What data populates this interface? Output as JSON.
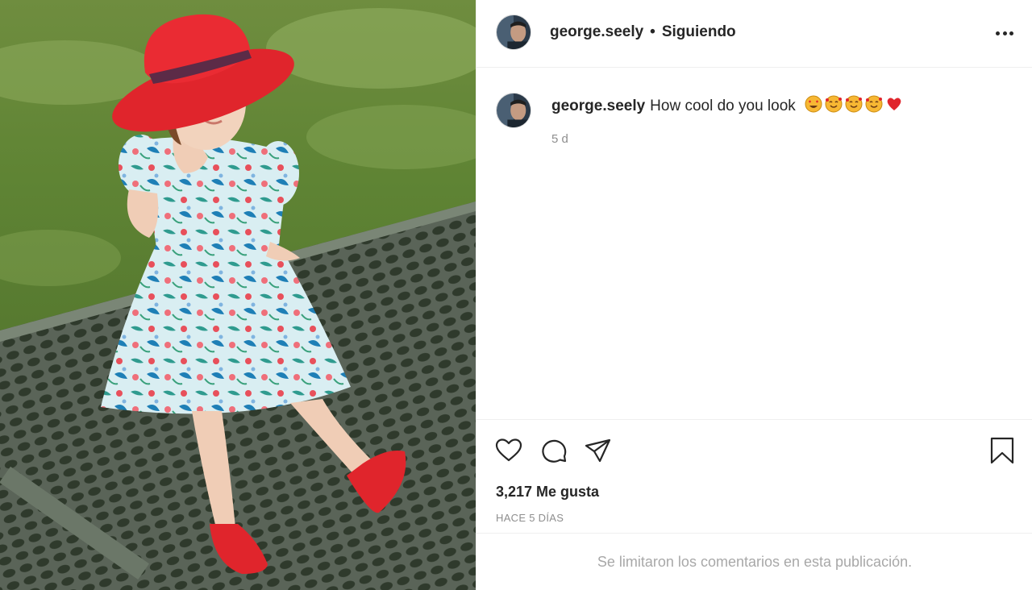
{
  "header": {
    "username": "george.seely",
    "separator": "•",
    "follow_status": "Siguiendo"
  },
  "caption": {
    "username": "george.seely",
    "text": "How cool do you look",
    "emojis": [
      "heart-eyes-emoji",
      "smiling-face-with-hearts-emoji",
      "smiling-face-with-hearts-emoji",
      "smiling-face-with-hearts-emoji",
      "red-heart-emoji"
    ],
    "time": "5 d"
  },
  "actions": {
    "like_icon": "heart-outline-icon",
    "comment_icon": "speech-bubble-icon",
    "share_icon": "paper-plane-icon",
    "save_icon": "bookmark-icon"
  },
  "stats": {
    "likes_count": "3,217",
    "likes_label": "Me gusta",
    "posted_ago": "HACE 5 DÍAS"
  },
  "footer": {
    "comments_limited": "Se limitaron los comentarios en esta publicación."
  },
  "colors": {
    "text": "#262626",
    "secondary_text": "#8e8e8e",
    "border": "#efefef",
    "hat_red": "#e0252c"
  }
}
